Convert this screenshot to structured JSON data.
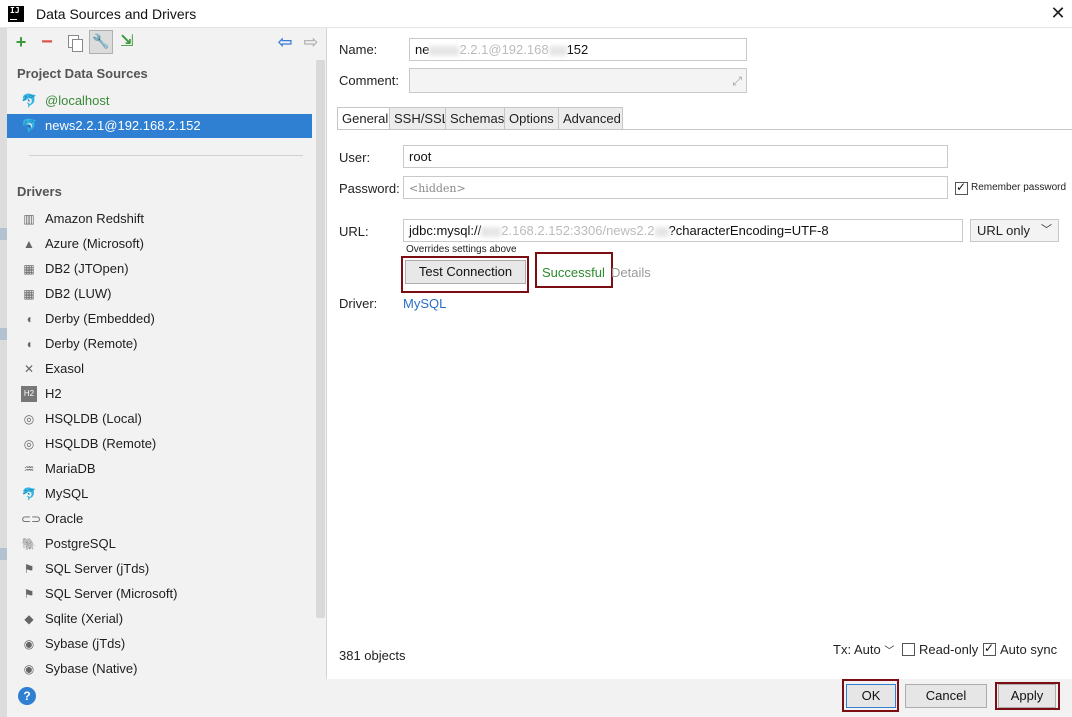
{
  "window": {
    "title": "Data Sources and Drivers"
  },
  "project_data_sources": {
    "heading": "Project Data Sources",
    "items": [
      {
        "label": "@localhost",
        "icon": "mysql-dolphin-icon"
      },
      {
        "label": "news2.2.1@192.168.2.152",
        "icon": "mysql-dolphin-icon",
        "selected": true
      }
    ]
  },
  "drivers": {
    "heading": "Drivers",
    "items": [
      {
        "label": "Amazon Redshift",
        "icon": "redshift-icon"
      },
      {
        "label": "Azure (Microsoft)",
        "icon": "azure-icon"
      },
      {
        "label": "DB2 (JTOpen)",
        "icon": "db2-icon"
      },
      {
        "label": "DB2 (LUW)",
        "icon": "db2-icon"
      },
      {
        "label": "Derby (Embedded)",
        "icon": "derby-icon"
      },
      {
        "label": "Derby (Remote)",
        "icon": "derby-icon"
      },
      {
        "label": "Exasol",
        "icon": "exasol-icon"
      },
      {
        "label": "H2",
        "icon": "h2-icon"
      },
      {
        "label": "HSQLDB (Local)",
        "icon": "hsqldb-icon"
      },
      {
        "label": "HSQLDB (Remote)",
        "icon": "hsqldb-icon"
      },
      {
        "label": "MariaDB",
        "icon": "mariadb-icon"
      },
      {
        "label": "MySQL",
        "icon": "mysql-dolphin-icon"
      },
      {
        "label": "Oracle",
        "icon": "oracle-icon"
      },
      {
        "label": "PostgreSQL",
        "icon": "postgresql-icon"
      },
      {
        "label": "SQL Server (jTds)",
        "icon": "sqlserver-icon"
      },
      {
        "label": "SQL Server (Microsoft)",
        "icon": "sqlserver-icon"
      },
      {
        "label": "Sqlite (Xerial)",
        "icon": "sqlite-icon"
      },
      {
        "label": "Sybase (jTds)",
        "icon": "sybase-icon"
      },
      {
        "label": "Sybase (Native)",
        "icon": "sybase-icon"
      }
    ]
  },
  "form": {
    "name_label": "Name:",
    "name_value_start": "ne",
    "name_value_mid": "2.2.1@192.168",
    "name_value_end": "152",
    "comment_label": "Comment:",
    "comment_value": "",
    "tabs": [
      "General",
      "SSH/SSL",
      "Schemas",
      "Options",
      "Advanced"
    ],
    "user_label": "User:",
    "user_value": "root",
    "password_label": "Password:",
    "password_value": "<hidden>",
    "remember_password": "Remember password",
    "url_label": "URL:",
    "url_value_start": "jdbc:mysql://",
    "url_value_mid": "2.168.2.152:3306/news2.2",
    "url_value_end": "?characterEncoding=UTF-8",
    "url_mode": "URL only",
    "overrides_note": "Overrides settings above",
    "test_connection": "Test Connection",
    "status": "Successful",
    "details": "Details",
    "driver_label": "Driver:",
    "driver_value": "MySQL"
  },
  "footer": {
    "objects_count": "381 objects",
    "tx_label": "Tx: Auto",
    "read_only": "Read-only",
    "read_only_checked": false,
    "auto_sync": "Auto sync",
    "auto_sync_checked": true,
    "ok": "OK",
    "cancel": "Cancel",
    "apply": "Apply",
    "help": "?"
  },
  "colors": {
    "selection": "#2f7fd2",
    "success": "#2b8a2b",
    "highlight_box": "#7a0e12",
    "link": "#2a6fc4"
  }
}
